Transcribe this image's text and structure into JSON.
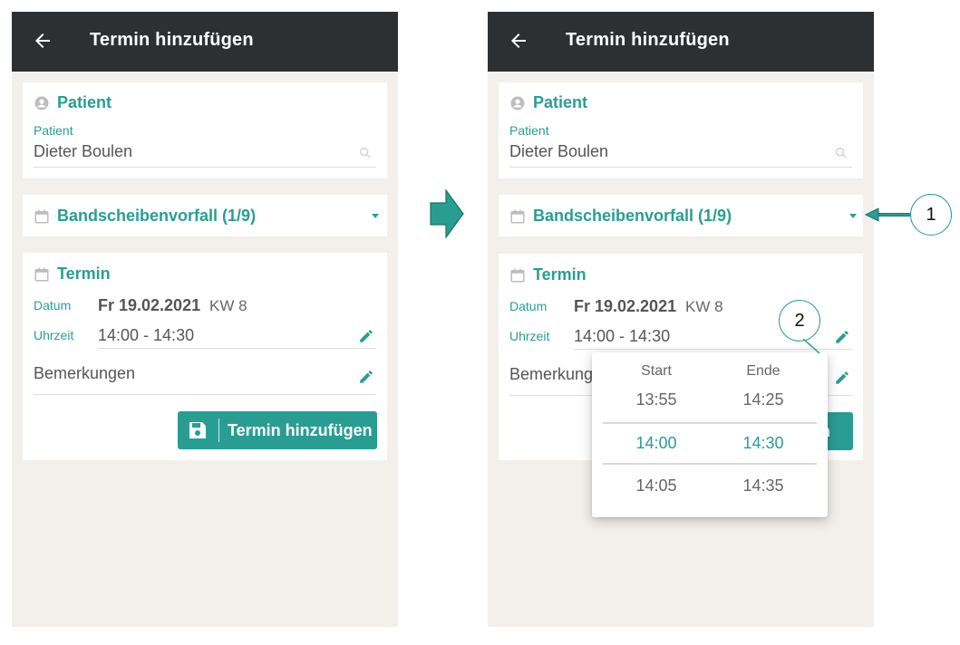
{
  "colors": {
    "accent": "#2a9d93",
    "appbar": "#2d3033",
    "background": "#f3f0ec"
  },
  "screens": [
    {
      "appbar": {
        "title": "Termin hinzufügen",
        "back_icon": "arrow-left-icon"
      },
      "patient": {
        "title": "Patient",
        "field_label": "Patient",
        "value": "Dieter Boulen"
      },
      "diagnosis": {
        "label": "Bandscheibenvorfall (1/9)"
      },
      "appointment": {
        "title": "Termin",
        "date_label": "Datum",
        "date_value": "Fr 19.02.2021",
        "week": "KW 8",
        "time_label": "Uhrzeit",
        "time_value": "14:00 - 14:30",
        "remarks_label": "Bemerkungen",
        "submit_label": "Termin hinzufügen"
      }
    },
    {
      "appbar": {
        "title": "Termin hinzufügen",
        "back_icon": "arrow-left-icon"
      },
      "patient": {
        "title": "Patient",
        "field_label": "Patient",
        "value": "Dieter Boulen"
      },
      "diagnosis": {
        "label": "Bandscheibenvorfall (1/9)"
      },
      "appointment": {
        "title": "Termin",
        "date_label": "Datum",
        "date_value": "Fr 19.02.2021",
        "week": "KW 8",
        "time_label": "Uhrzeit",
        "time_value": "14:00 - 14:30",
        "remarks_label": "Bemerkungen",
        "submit_label_visible": "en"
      },
      "time_picker": {
        "start_header": "Start",
        "end_header": "Ende",
        "rows": [
          {
            "start": "13:55",
            "end": "14:25",
            "selected": false
          },
          {
            "start": "14:00",
            "end": "14:30",
            "selected": true
          },
          {
            "start": "14:05",
            "end": "14:35",
            "selected": false
          }
        ]
      }
    }
  ],
  "annotations": {
    "callout_1": "1",
    "callout_2": "2"
  }
}
